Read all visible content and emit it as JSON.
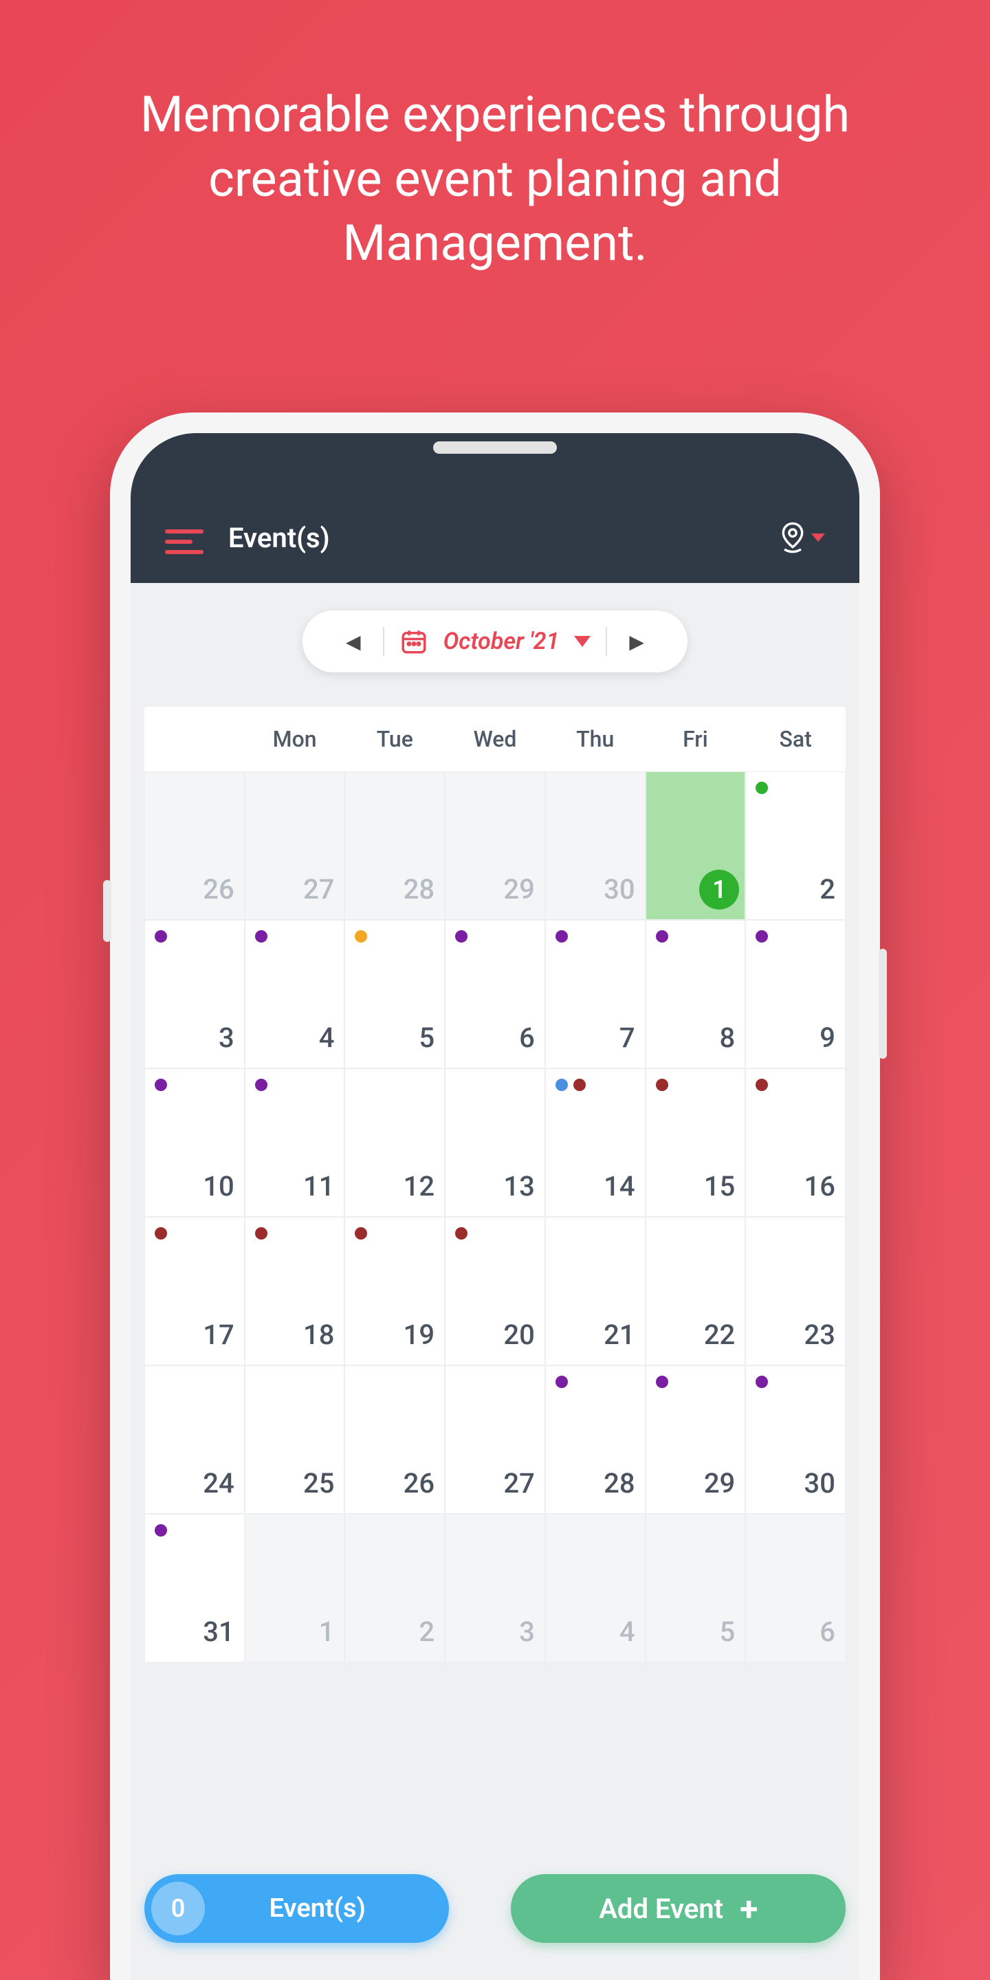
{
  "hero": "Memorable experiences through creative event planing and Management.",
  "header": {
    "title": "Event(s)"
  },
  "monthSelector": {
    "label": "October '21"
  },
  "dow": [
    "Mon",
    "Tue",
    "Wed",
    "Thu",
    "Fri",
    "Sat"
  ],
  "calendar": {
    "rows": [
      [
        {
          "n": "26",
          "out": true
        },
        {
          "n": "27",
          "out": true
        },
        {
          "n": "28",
          "out": true
        },
        {
          "n": "29",
          "out": true
        },
        {
          "n": "30",
          "out": true
        },
        {
          "n": "1",
          "today": true
        },
        {
          "n": "2",
          "dots": [
            "green"
          ]
        }
      ],
      [
        {
          "n": "3",
          "dots": [
            "purple"
          ]
        },
        {
          "n": "4",
          "dots": [
            "purple"
          ]
        },
        {
          "n": "5",
          "dots": [
            "orange"
          ]
        },
        {
          "n": "6",
          "dots": [
            "purple"
          ]
        },
        {
          "n": "7",
          "dots": [
            "purple"
          ]
        },
        {
          "n": "8",
          "dots": [
            "purple"
          ]
        },
        {
          "n": "9",
          "dots": [
            "purple"
          ]
        }
      ],
      [
        {
          "n": "10",
          "dots": [
            "purple"
          ]
        },
        {
          "n": "11",
          "dots": [
            "purple"
          ]
        },
        {
          "n": "12"
        },
        {
          "n": "13"
        },
        {
          "n": "14",
          "dots": [
            "blue",
            "darkred"
          ]
        },
        {
          "n": "15",
          "dots": [
            "darkred"
          ]
        },
        {
          "n": "16",
          "dots": [
            "darkred"
          ]
        }
      ],
      [
        {
          "n": "17",
          "dots": [
            "darkred"
          ]
        },
        {
          "n": "18",
          "dots": [
            "darkred"
          ]
        },
        {
          "n": "19",
          "dots": [
            "darkred"
          ]
        },
        {
          "n": "20",
          "dots": [
            "darkred"
          ]
        },
        {
          "n": "21"
        },
        {
          "n": "22"
        },
        {
          "n": "23"
        }
      ],
      [
        {
          "n": "24"
        },
        {
          "n": "25"
        },
        {
          "n": "26"
        },
        {
          "n": "27"
        },
        {
          "n": "28",
          "dots": [
            "purple"
          ]
        },
        {
          "n": "29",
          "dots": [
            "purple"
          ]
        },
        {
          "n": "30",
          "dots": [
            "purple"
          ]
        }
      ],
      [
        {
          "n": "31",
          "dots": [
            "purple"
          ]
        },
        {
          "n": "1",
          "out": true
        },
        {
          "n": "2",
          "out": true
        },
        {
          "n": "3",
          "out": true
        },
        {
          "n": "4",
          "out": true
        },
        {
          "n": "5",
          "out": true
        },
        {
          "n": "6",
          "out": true
        }
      ]
    ]
  },
  "footer": {
    "count": "0",
    "countLabel": "Event(s)",
    "addLabel": "Add Event"
  },
  "colors": {
    "purple": "#7b1fa2",
    "orange": "#f5a623",
    "darkred": "#9b2c2c",
    "blue": "#4a90e2",
    "green": "#2eb12e"
  }
}
